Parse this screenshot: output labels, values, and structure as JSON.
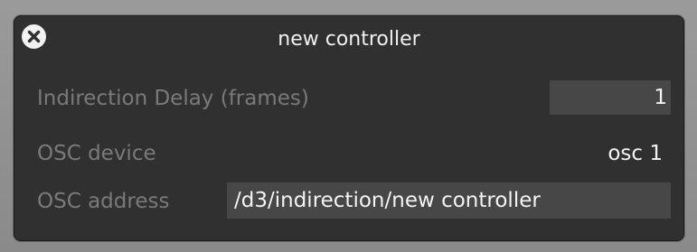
{
  "window": {
    "title": "new controller",
    "close_icon": "close-circle-icon"
  },
  "fields": {
    "indirection_delay": {
      "label": "Indirection Delay (frames)",
      "value": "1"
    },
    "osc_device": {
      "label": "OSC device",
      "value": "osc 1"
    },
    "osc_address": {
      "label": "OSC address",
      "value": "/d3/indirection/new controller"
    }
  },
  "colors": {
    "panel_bg": "#303030",
    "field_bg": "#474747",
    "label_text": "#7a7a7a",
    "value_text": "#f4f4f4"
  }
}
